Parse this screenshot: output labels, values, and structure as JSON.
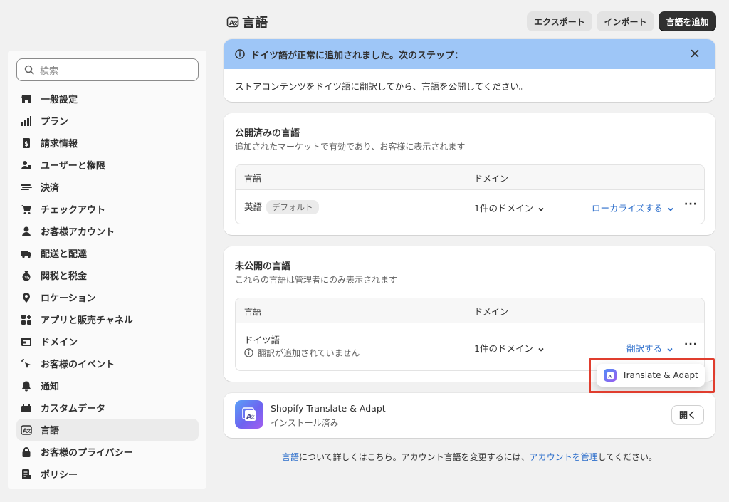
{
  "header": {
    "title": "言語",
    "export_label": "エクスポート",
    "import_label": "インポート",
    "add_language_label": "言語を追加"
  },
  "sidebar": {
    "search_placeholder": "検索",
    "items": [
      {
        "label": "一般設定",
        "icon": "store-icon"
      },
      {
        "label": "プラン",
        "icon": "plan-icon"
      },
      {
        "label": "請求情報",
        "icon": "billing-icon"
      },
      {
        "label": "ユーザーと権限",
        "icon": "users-icon"
      },
      {
        "label": "決済",
        "icon": "payments-icon"
      },
      {
        "label": "チェックアウト",
        "icon": "cart-icon"
      },
      {
        "label": "お客様アカウント",
        "icon": "person-icon"
      },
      {
        "label": "配送と配達",
        "icon": "truck-icon"
      },
      {
        "label": "関税と税金",
        "icon": "tax-icon"
      },
      {
        "label": "ロケーション",
        "icon": "location-icon"
      },
      {
        "label": "アプリと販売チャネル",
        "icon": "apps-icon"
      },
      {
        "label": "ドメイン",
        "icon": "domain-icon"
      },
      {
        "label": "お客様のイベント",
        "icon": "cursor-icon"
      },
      {
        "label": "通知",
        "icon": "bell-icon"
      },
      {
        "label": "カスタムデータ",
        "icon": "custom-data-icon"
      },
      {
        "label": "言語",
        "icon": "language-icon"
      },
      {
        "label": "お客様のプライバシー",
        "icon": "lock-icon"
      },
      {
        "label": "ポリシー",
        "icon": "policy-icon"
      }
    ]
  },
  "banner": {
    "title": "ドイツ語が正常に追加されました。次のステップ：",
    "body": "ストアコンテンツをドイツ語に翻訳してから、言語を公開してください。"
  },
  "published": {
    "title": "公開済みの言語",
    "subtitle": "追加されたマーケットで有効であり、お客様に表示されます",
    "col_language": "言語",
    "col_domain": "ドメイン",
    "row": {
      "language": "英語",
      "badge": "デフォルト",
      "domain": "1件のドメイン",
      "action": "ローカライズする"
    }
  },
  "unpublished": {
    "title": "未公開の言語",
    "subtitle": "これらの言語は管理者にのみ表示されます",
    "col_language": "言語",
    "col_domain": "ドメイン",
    "row": {
      "language": "ドイツ語",
      "note": "翻訳が追加されていません",
      "domain": "1件のドメイン",
      "action": "翻訳する"
    }
  },
  "popover": {
    "item_label": "Translate & Adapt"
  },
  "app": {
    "name": "Shopify Translate & Adapt",
    "status": "インストール済み",
    "open_label": "開く"
  },
  "footer": {
    "link1": "言語",
    "text1": "について詳しくはこちら。アカウント言語を変更するには、",
    "link2": "アカウントを管理",
    "text2": "してください。"
  },
  "colors": {
    "banner_bg": "#9ec6f7",
    "link": "#2c6ecb",
    "highlight": "#e03d2e",
    "primary_button": "#303030"
  }
}
